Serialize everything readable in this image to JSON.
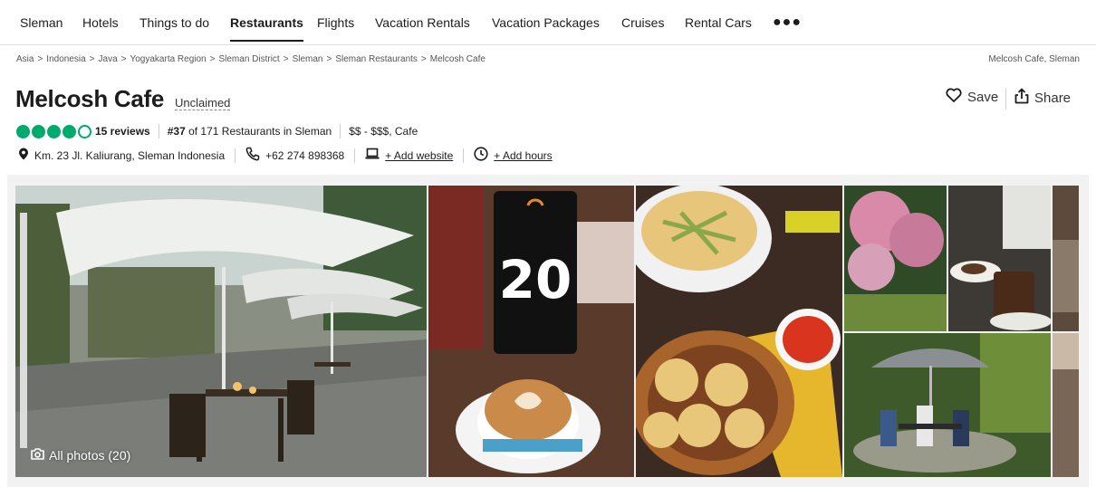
{
  "nav": {
    "items": [
      {
        "label": "Sleman",
        "active": false
      },
      {
        "label": "Hotels",
        "active": false
      },
      {
        "label": "Things to do",
        "active": false
      },
      {
        "label": "Restaurants",
        "active": true
      },
      {
        "label": "Flights",
        "active": false
      },
      {
        "label": "Vacation Rentals",
        "active": false
      },
      {
        "label": "Vacation Packages",
        "active": false
      },
      {
        "label": "Cruises",
        "active": false
      },
      {
        "label": "Rental Cars",
        "active": false
      }
    ],
    "more_icon": "more-dots-icon"
  },
  "breadcrumb": {
    "items": [
      "Asia",
      "Indonesia",
      "Java",
      "Yogyakarta Region",
      "Sleman District",
      "Sleman",
      "Sleman Restaurants",
      "Melcosh Cafe"
    ],
    "separator": ">",
    "right_text": "Melcosh Cafe, Sleman"
  },
  "header": {
    "title": "Melcosh Cafe",
    "claim_status": "Unclaimed",
    "save_label": "Save",
    "share_label": "Share"
  },
  "rating": {
    "bubbles_filled": 4,
    "bubbles_total": 5,
    "reviews_label": "15 reviews",
    "rank_number": "#37",
    "rank_text": "of 171 Restaurants in Sleman",
    "price_cuisine": "$$ - $$$, Cafe",
    "accent_color": "#00aa6c"
  },
  "info": {
    "address": "Km. 23 Jl. Kaliurang, Sleman Indonesia",
    "phone": "+62 274 898368",
    "website_link": "+ Add website",
    "hours_link": "+ Add hours"
  },
  "photos": {
    "all_photos_label": "All photos (20)"
  }
}
